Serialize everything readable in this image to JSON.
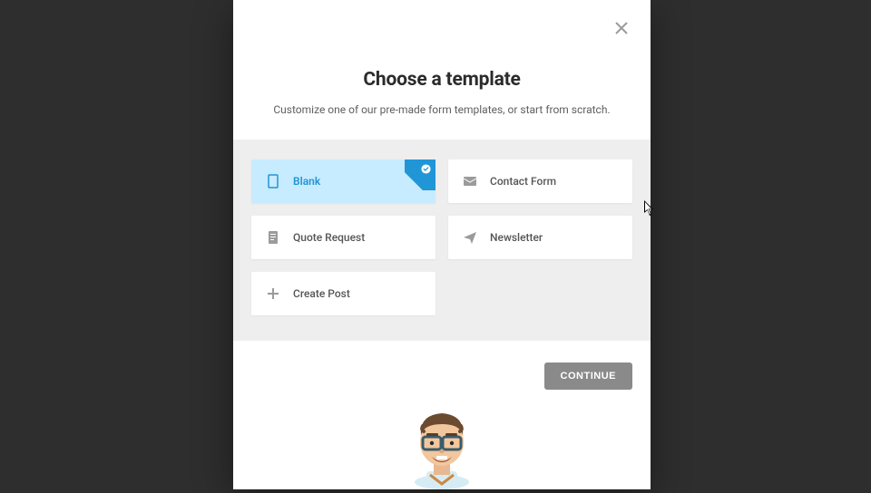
{
  "modal": {
    "title": "Choose a template",
    "subtitle": "Customize one of our pre-made form templates, or start from scratch.",
    "continue_label": "CONTINUE"
  },
  "templates": [
    {
      "label": "Blank",
      "icon": "file-icon",
      "selected": true
    },
    {
      "label": "Contact Form",
      "icon": "mail-icon",
      "selected": false
    },
    {
      "label": "Quote Request",
      "icon": "document-icon",
      "selected": false
    },
    {
      "label": "Newsletter",
      "icon": "send-icon",
      "selected": false
    },
    {
      "label": "Create Post",
      "icon": "plus-icon",
      "selected": false
    }
  ]
}
